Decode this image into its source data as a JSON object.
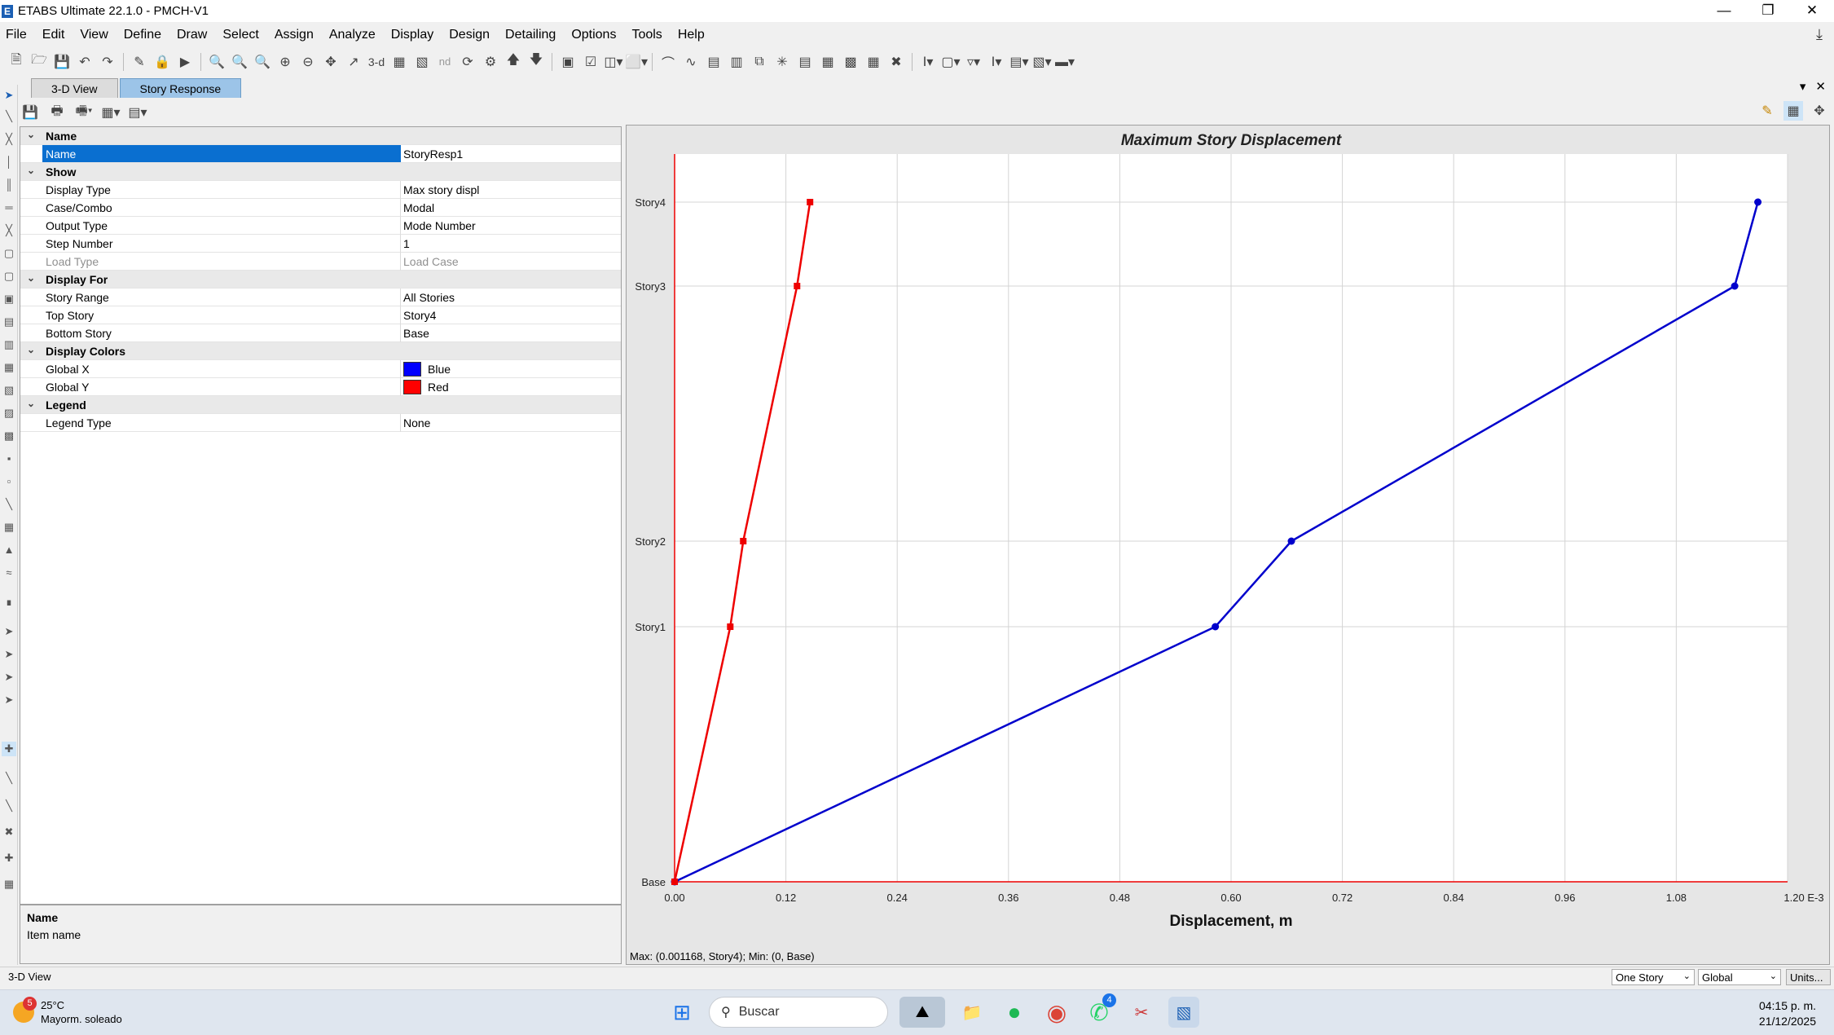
{
  "window": {
    "title": "ETABS Ultimate 22.1.0 - PMCH-V1",
    "app_letter": "E"
  },
  "menu": [
    "File",
    "Edit",
    "View",
    "Define",
    "Draw",
    "Select",
    "Assign",
    "Analyze",
    "Display",
    "Design",
    "Detailing",
    "Options",
    "Tools",
    "Help"
  ],
  "toolbar_text": {
    "threed": "3-d",
    "nd": "nd"
  },
  "tabs": [
    {
      "label": "3-D View"
    },
    {
      "label": "Story Response"
    }
  ],
  "properties": {
    "cat_name": "Name",
    "name_label": "Name",
    "name_value": "StoryResp1",
    "cat_show": "Show",
    "display_type_label": "Display Type",
    "display_type_value": "Max story displ",
    "case_label": "Case/Combo",
    "case_value": "Modal",
    "output_type_label": "Output Type",
    "output_type_value": "Mode Number",
    "step_label": "Step Number",
    "step_value": "1",
    "load_type_label": "Load Type",
    "load_type_value": "Load Case",
    "cat_display_for": "Display For",
    "story_range_label": "Story Range",
    "story_range_value": "All Stories",
    "top_story_label": "Top Story",
    "top_story_value": "Story4",
    "bottom_story_label": "Bottom Story",
    "bottom_story_value": "Base",
    "cat_display_colors": "Display Colors",
    "global_x_label": "Global X",
    "global_x_value": "Blue",
    "global_x_color": "#0000ff",
    "global_y_label": "Global Y",
    "global_y_value": "Red",
    "global_y_color": "#ff0000",
    "cat_legend": "Legend",
    "legend_type_label": "Legend Type",
    "legend_type_value": "None"
  },
  "description": {
    "title": "Name",
    "text": "Item name"
  },
  "chart_data": {
    "type": "line",
    "title": "Maximum Story Displacement",
    "xlabel": "Displacement, m",
    "x_unit_suffix": "E-3",
    "xlim": [
      0,
      1.2
    ],
    "x_ticks": [
      "0.00",
      "0.12",
      "0.24",
      "0.36",
      "0.48",
      "0.60",
      "0.72",
      "0.84",
      "0.96",
      "1.08",
      "1.20"
    ],
    "categories": [
      "Base",
      "Story1",
      "Story2",
      "Story3",
      "Story4"
    ],
    "series": [
      {
        "color": "#0000cc",
        "values": [
          0,
          0.583,
          0.665,
          1.143,
          1.168
        ]
      },
      {
        "color": "#ee0000",
        "values": [
          0,
          0.06,
          0.074,
          0.132,
          0.146
        ]
      }
    ],
    "grid": true,
    "status": "Max: (0.001168, Story4);  Min: (0, Base)"
  },
  "statusbar": {
    "left": "3-D View",
    "story_mode": "One Story",
    "coord": "Global",
    "units_button": "Units..."
  },
  "taskbar": {
    "weather_badge": "5",
    "temperature": "25°C",
    "condition": "Mayorm. soleado",
    "search_placeholder": "Buscar",
    "whatsapp_badge": "4",
    "time": "04:15 p. m.",
    "date": "21/12/2025"
  }
}
